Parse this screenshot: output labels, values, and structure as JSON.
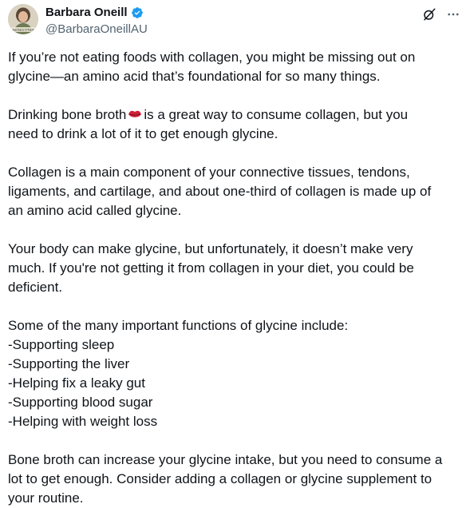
{
  "author": {
    "name": "Barbara Oneill",
    "handle": "@BarbaraOneillAU",
    "avatar_caption": "Barbara O'Neill"
  },
  "icons": {
    "verified": "verified-badge-icon",
    "grok": "grok-icon",
    "more": "more-options-icon",
    "emoji": "lips-icon"
  },
  "colors": {
    "verified": "#1d9bf0",
    "text": "#0f1419",
    "secondary": "#536471"
  },
  "post": {
    "p1": [
      "If you’re not eating foods with collagen, you might be missing out on",
      "glycine—an amino acid that’s foundational for so many things."
    ],
    "p2_line1_before": "Drinking bone broth",
    "p2_line1_after": "is a great way to consume collagen, but you",
    "p2_line2": "need to drink a lot of it to get enough glycine.",
    "p3": [
      "Collagen is a main component of your connective tissues, tendons,",
      "ligaments, and cartilage, and about one-third of collagen is made up of",
      "an amino acid called glycine."
    ],
    "p4": [
      "Your body can make glycine, but unfortunately, it doesn’t make very",
      "much. If you're not getting it from collagen in your diet, you could be",
      "deficient."
    ],
    "p5": [
      "Some of the many important functions of glycine include:",
      "-Supporting sleep",
      "-Supporting the liver",
      "-Helping fix a leaky gut",
      "-Supporting blood sugar",
      "-Helping with weight loss"
    ],
    "p6": [
      "Bone broth can increase your glycine intake, but you need to consume a",
      "lot to get enough. Consider adding a collagen or glycine supplement to",
      "your routine."
    ]
  }
}
